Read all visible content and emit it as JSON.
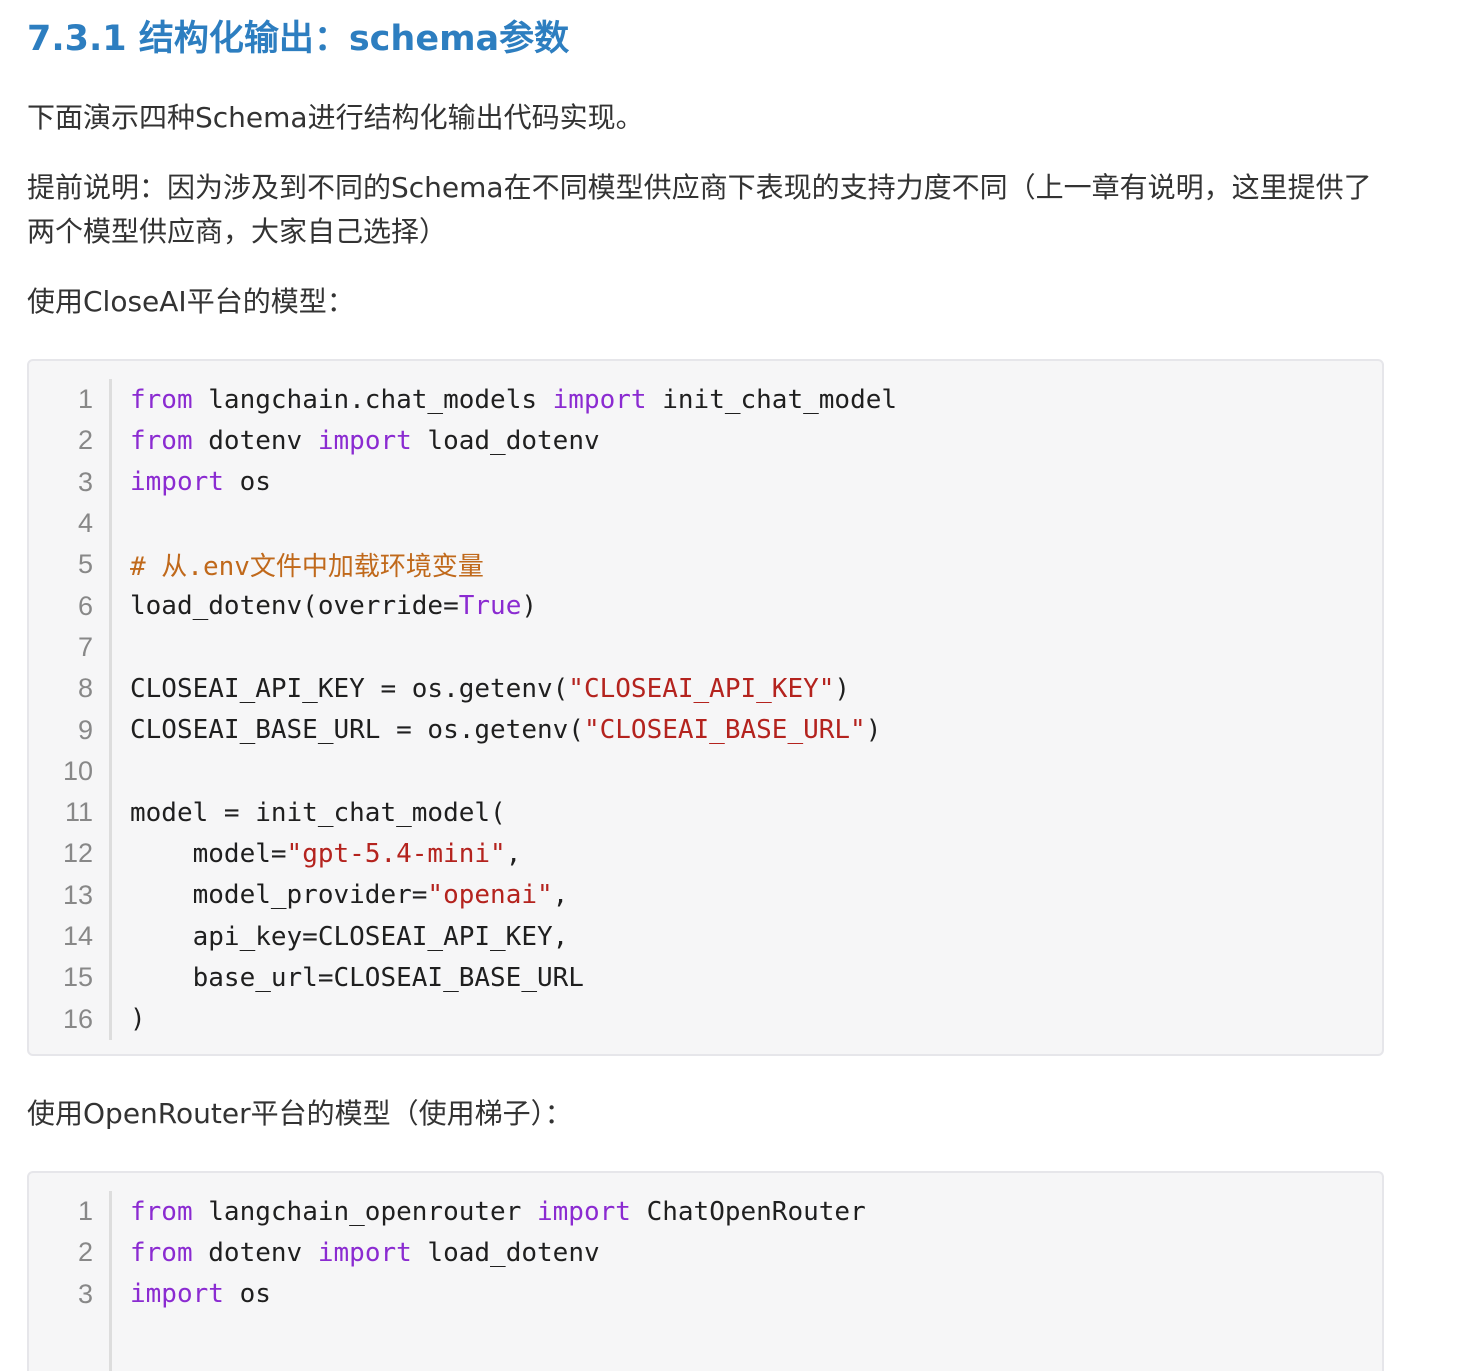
{
  "heading": "7.3.1 结构化输出：schema参数",
  "paragraphs": {
    "intro": "下面演示四种Schema进行结构化输出代码实现。",
    "note": "提前说明：因为涉及到不同的Schema在不同模型供应商下表现的支持力度不同（上一章有说明，这里提供了两个模型供应商，大家自己选择）",
    "closeai_label": "使用CloseAI平台的模型：",
    "openrouter_label": "使用OpenRouter平台的模型（使用梯子）："
  },
  "code_block_1": {
    "lines": [
      {
        "n": "1",
        "tokens": [
          [
            "kw",
            "from"
          ],
          [
            "t",
            " langchain.chat_models "
          ],
          [
            "kw",
            "import"
          ],
          [
            "t",
            " init_chat_model"
          ]
        ]
      },
      {
        "n": "2",
        "tokens": [
          [
            "kw",
            "from"
          ],
          [
            "t",
            " dotenv "
          ],
          [
            "kw",
            "import"
          ],
          [
            "t",
            " load_dotenv"
          ]
        ]
      },
      {
        "n": "3",
        "tokens": [
          [
            "kw",
            "import"
          ],
          [
            "t",
            " os"
          ]
        ]
      },
      {
        "n": "4",
        "tokens": []
      },
      {
        "n": "5",
        "tokens": [
          [
            "cm",
            "# 从.env文件中加载环境变量"
          ]
        ]
      },
      {
        "n": "6",
        "tokens": [
          [
            "t",
            "load_dotenv(override="
          ],
          [
            "bool",
            "True"
          ],
          [
            "t",
            ")"
          ]
        ]
      },
      {
        "n": "7",
        "tokens": []
      },
      {
        "n": "8",
        "tokens": [
          [
            "t",
            "CLOSEAI_API_KEY = os.getenv("
          ],
          [
            "str",
            "\"CLOSEAI_API_KEY\""
          ],
          [
            "t",
            ")"
          ]
        ]
      },
      {
        "n": "9",
        "tokens": [
          [
            "t",
            "CLOSEAI_BASE_URL = os.getenv("
          ],
          [
            "str",
            "\"CLOSEAI_BASE_URL\""
          ],
          [
            "t",
            ")"
          ]
        ]
      },
      {
        "n": "10",
        "tokens": []
      },
      {
        "n": "11",
        "tokens": [
          [
            "t",
            "model = init_chat_model("
          ]
        ]
      },
      {
        "n": "12",
        "tokens": [
          [
            "t",
            "    model="
          ],
          [
            "str",
            "\"gpt-5.4-mini\""
          ],
          [
            "t",
            ","
          ]
        ]
      },
      {
        "n": "13",
        "tokens": [
          [
            "t",
            "    model_provider="
          ],
          [
            "str",
            "\"openai\""
          ],
          [
            "t",
            ","
          ]
        ]
      },
      {
        "n": "14",
        "tokens": [
          [
            "t",
            "    api_key=CLOSEAI_API_KEY,"
          ]
        ]
      },
      {
        "n": "15",
        "tokens": [
          [
            "t",
            "    base_url=CLOSEAI_BASE_URL"
          ]
        ]
      },
      {
        "n": "16",
        "tokens": [
          [
            "t",
            ")"
          ]
        ]
      }
    ]
  },
  "code_block_2": {
    "lines": [
      {
        "n": "1",
        "tokens": [
          [
            "kw",
            "from"
          ],
          [
            "t",
            " langchain_openrouter "
          ],
          [
            "kw",
            "import"
          ],
          [
            "t",
            " ChatOpenRouter"
          ]
        ]
      },
      {
        "n": "2",
        "tokens": [
          [
            "kw",
            "from"
          ],
          [
            "t",
            " dotenv "
          ],
          [
            "kw",
            "import"
          ],
          [
            "t",
            " load_dotenv"
          ]
        ]
      },
      {
        "n": "3",
        "tokens": [
          [
            "kw",
            "import"
          ],
          [
            "t",
            " os"
          ]
        ]
      }
    ]
  },
  "colors": {
    "heading": "#2d7ec0",
    "keyword": "#8b2bd1",
    "string": "#b4231e",
    "comment": "#c0691b",
    "code_bg": "#f6f6f7"
  }
}
